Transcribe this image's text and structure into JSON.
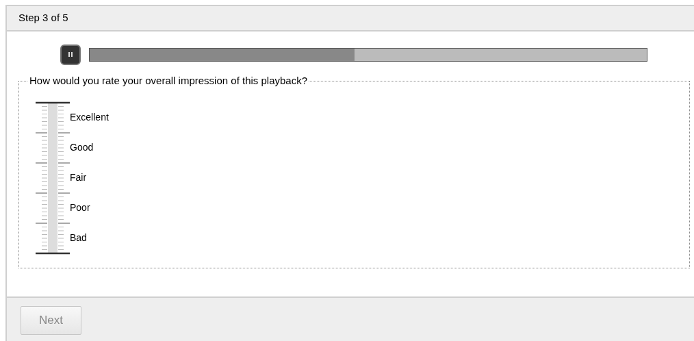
{
  "header": {
    "step": "Step 3 of 5"
  },
  "player": {
    "playing": true,
    "level": 0.476
  },
  "question": {
    "legend": "How would you rate your overall impression of this playback?",
    "scale_labels": [
      "Excellent",
      "Good",
      "Fair",
      "Poor",
      "Bad"
    ]
  },
  "footer": {
    "next_button": {
      "label": "Next",
      "disabled": true
    }
  }
}
